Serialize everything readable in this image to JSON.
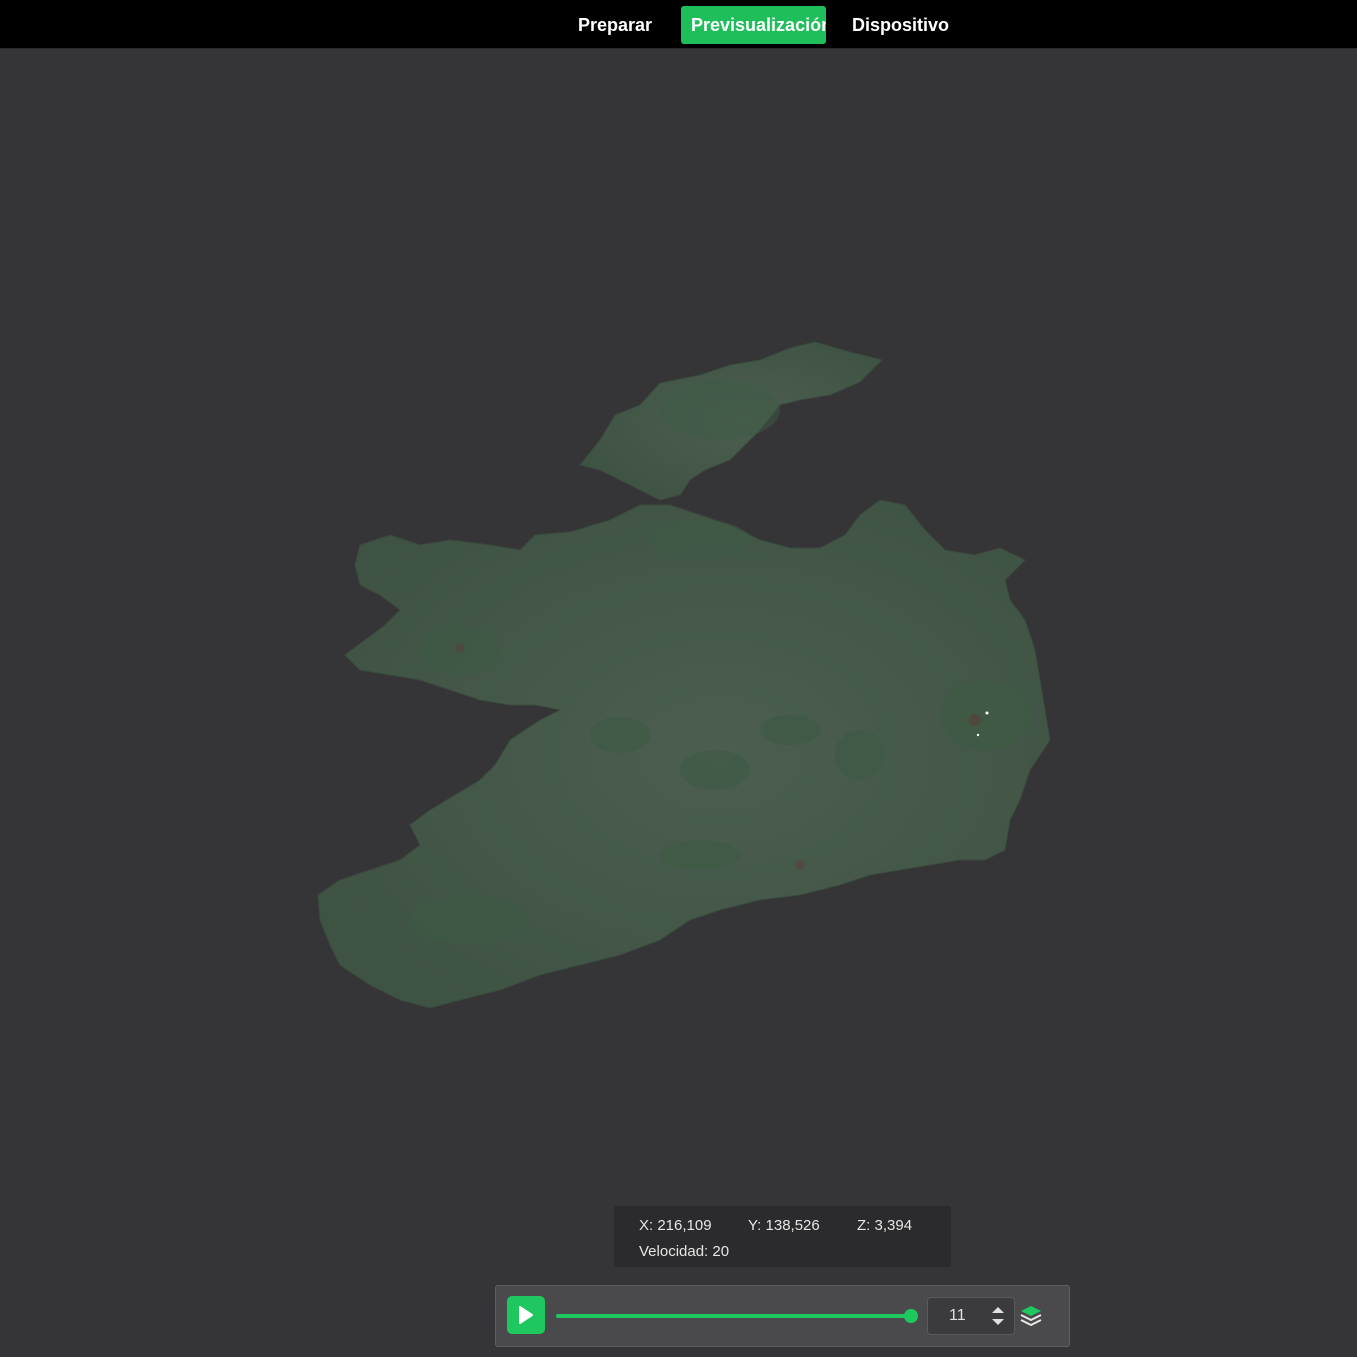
{
  "tabs": [
    {
      "label": "Preparar",
      "active": false
    },
    {
      "label": "Previsualización",
      "active": true
    },
    {
      "label": "Dispositivo",
      "active": false
    }
  ],
  "coords": {
    "x": "X: 216,109",
    "y": "Y: 138,526",
    "z": "Z: 3,394",
    "velocity": "Velocidad: 20"
  },
  "player": {
    "layer_value": "11",
    "progress": 1.0
  },
  "icons": {
    "play": "play-icon",
    "spin_up": "chevron-up-icon",
    "spin_down": "chevron-down-icon",
    "layers": "layers-icon"
  },
  "colors": {
    "accent": "#1ebe5a",
    "background": "#353537",
    "topbar": "#000000",
    "terrain": "#465a4b"
  }
}
